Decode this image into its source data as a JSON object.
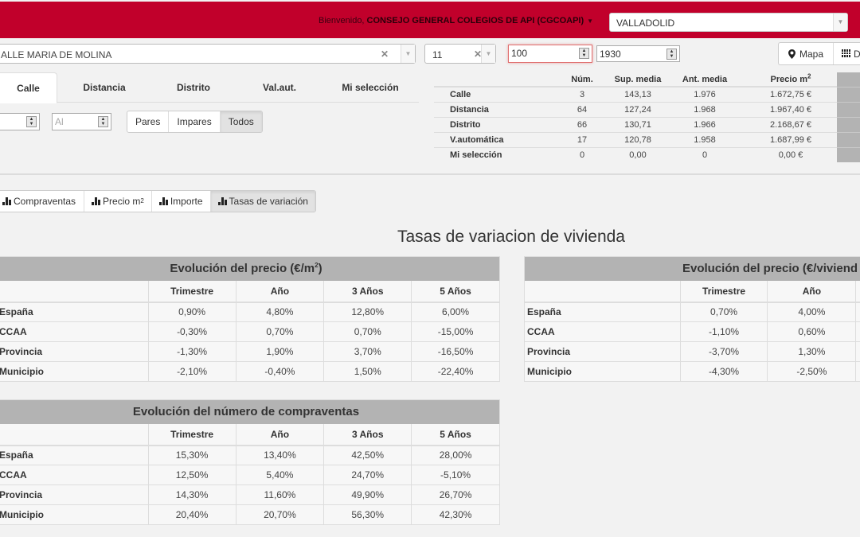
{
  "header": {
    "welcome_prefix": "Bienvenido, ",
    "user_name": "CONSEJO GENERAL COLEGIOS DE API (CGCOAPI)",
    "city_selected": "VALLADOLID",
    "brand_color": "#c1002b"
  },
  "search": {
    "street_value": "ALLE MARIA DE MOLINA",
    "number_value": "11",
    "surface_value": "100",
    "year_value": "1930",
    "map_button": "Mapa",
    "data_button": "Dat"
  },
  "tabs": [
    {
      "label": "Calle",
      "active": true
    },
    {
      "label": "Distancia",
      "active": false
    },
    {
      "label": "Distrito",
      "active": false
    },
    {
      "label": "Val.aut.",
      "active": false
    },
    {
      "label": "Mi selección",
      "active": false
    }
  ],
  "filters": {
    "from_value": "",
    "to_placeholder": "Al",
    "parity_options": [
      "Pares",
      "Impares",
      "Todos"
    ],
    "parity_selected": "Todos"
  },
  "stats": {
    "headers": [
      "",
      "Núm.",
      "Sup. media",
      "Ant. media",
      "Precio m"
    ],
    "headers_sup": "2",
    "rows": [
      {
        "label": "Calle",
        "num": "3",
        "sup": "143,13",
        "ant": "1.976",
        "precio": "1.672,75 €"
      },
      {
        "label": "Distancia",
        "num": "64",
        "sup": "127,24",
        "ant": "1.968",
        "precio": "1.967,40 €"
      },
      {
        "label": "Distrito",
        "num": "66",
        "sup": "130,71",
        "ant": "1.966",
        "precio": "2.168,67 €"
      },
      {
        "label": "V.automática",
        "num": "17",
        "sup": "120,78",
        "ant": "1.958",
        "precio": "1.687,99 €"
      },
      {
        "label": "Mi selección",
        "num": "0",
        "sup": "0,00",
        "ant": "0",
        "precio": "0,00 €"
      }
    ]
  },
  "chart_tabs": [
    {
      "label": "Compraventas",
      "active": false
    },
    {
      "label": "Precio m",
      "sup": "2",
      "active": false
    },
    {
      "label": "Importe",
      "active": false
    },
    {
      "label": "Tasas de variación",
      "active": true
    }
  ],
  "page_title": "Tasas de variacion de vivienda",
  "tables": {
    "price_m2": {
      "title": "Evolución del precio (€/m",
      "title_sup": "2",
      "title_end": ")",
      "columns": [
        "",
        "Trimestre",
        "Año",
        "3 Años",
        "5 Años"
      ],
      "rows": [
        {
          "label": "España",
          "values": [
            "0,90%",
            "4,80%",
            "12,80%",
            "6,00%"
          ]
        },
        {
          "label": "CCAA",
          "values": [
            "-0,30%",
            "0,70%",
            "0,70%",
            "-15,00%"
          ]
        },
        {
          "label": "Provincia",
          "values": [
            "-1,30%",
            "1,90%",
            "3,70%",
            "-16,50%"
          ]
        },
        {
          "label": "Municipio",
          "values": [
            "-2,10%",
            "-0,40%",
            "1,50%",
            "-22,40%"
          ]
        }
      ]
    },
    "price_dwelling": {
      "title": "Evolución del precio (€/viviend",
      "columns": [
        "",
        "Trimestre",
        "Año"
      ],
      "rows": [
        {
          "label": "España",
          "values": [
            "0,70%",
            "4,00%"
          ]
        },
        {
          "label": "CCAA",
          "values": [
            "-1,10%",
            "0,60%"
          ]
        },
        {
          "label": "Provincia",
          "values": [
            "-3,70%",
            "1,30%"
          ]
        },
        {
          "label": "Municipio",
          "values": [
            "-4,30%",
            "-2,50%"
          ]
        }
      ]
    },
    "sales": {
      "title": "Evolución del número de compraventas",
      "columns": [
        "",
        "Trimestre",
        "Año",
        "3 Años",
        "5 Años"
      ],
      "rows": [
        {
          "label": "España",
          "values": [
            "15,30%",
            "13,40%",
            "42,50%",
            "28,00%"
          ]
        },
        {
          "label": "CCAA",
          "values": [
            "12,50%",
            "5,40%",
            "24,70%",
            "-5,10%"
          ]
        },
        {
          "label": "Provincia",
          "values": [
            "14,30%",
            "11,60%",
            "49,90%",
            "26,70%"
          ]
        },
        {
          "label": "Municipio",
          "values": [
            "20,40%",
            "20,70%",
            "56,30%",
            "42,30%"
          ]
        }
      ]
    }
  }
}
